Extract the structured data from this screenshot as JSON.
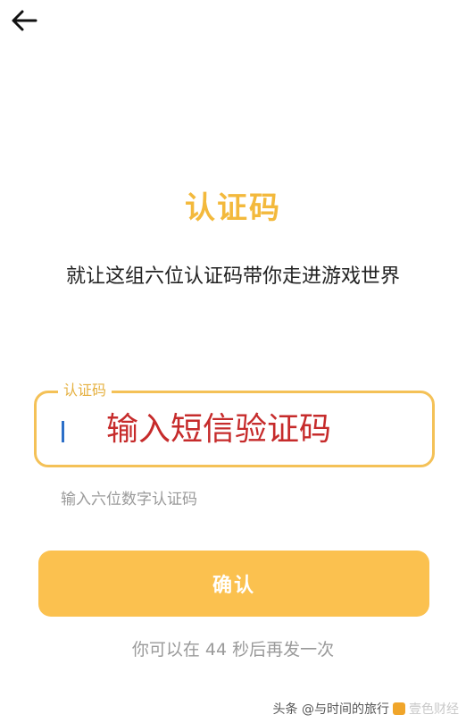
{
  "header": {
    "back_icon": "arrow-left-icon"
  },
  "main": {
    "title": "认证码",
    "subtitle": "就让这组六位认证码带你走进游戏世界",
    "code_field": {
      "label": "认证码",
      "placeholder": "输入短信验证码"
    },
    "hint": "输入六位数字认证码",
    "confirm_label": "确认",
    "resend_text": "你可以在 44 秒后再发一次"
  },
  "watermark": {
    "source": "头条 @与时间的旅行",
    "faded": "壹色财经"
  },
  "colors": {
    "accent": "#f3b93c",
    "button": "#fbc14f",
    "field_border": "#f4c157",
    "placeholder": "#c62b2b"
  }
}
